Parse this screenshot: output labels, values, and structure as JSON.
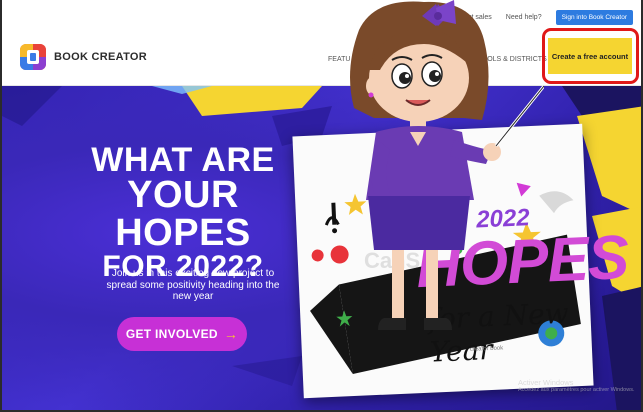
{
  "utility_bar": {
    "search_icon": "magnifier",
    "contact_sales": "Contact sales",
    "need_help": "Need help?",
    "sign_in": "Sign into Book Creator"
  },
  "nav": {
    "logo_text": "BOOK CREATOR",
    "features": "FEATU",
    "schools": "SCHOOLS & DISTRICTS",
    "cta": "Create a free account"
  },
  "hero": {
    "headline_line1": "WHAT ARE",
    "headline_line2": "YOUR HOPES",
    "headline_line3": "FOR 2022?",
    "subtext": "Join us in this exciting new project to spread some positivity heading into the new year",
    "button_label": "GET INVOLVED",
    "button_arrow": "→"
  },
  "book": {
    "year": "2022",
    "title": "HOPES",
    "subtitle": "for a New Year",
    "credit": "creator book"
  },
  "watermark": "CanS",
  "activate": {
    "title": "Activer Windows",
    "sub": "Accédez aux paramètres pour activer Windows."
  },
  "colors": {
    "hero_bg": "#3a28b8",
    "cta_bg": "#f5d531",
    "cta_highlight": "#e01818",
    "sign_in_bg": "#2d7be0",
    "get_involved_bg": "#c730d6"
  }
}
